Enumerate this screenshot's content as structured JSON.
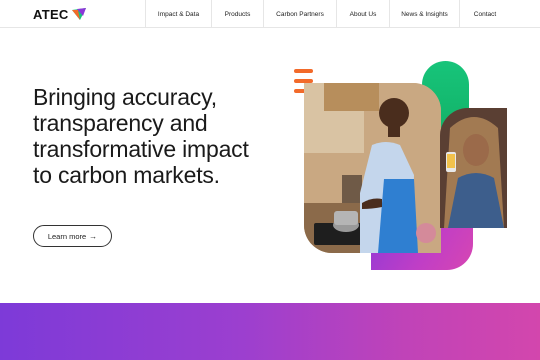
{
  "brand": {
    "name": "ATEC",
    "accent_green": "#17c47a",
    "accent_orange": "#f26a2a",
    "accent_purple": "#8a38d8",
    "accent_magenta": "#d346ad"
  },
  "nav": {
    "items": [
      {
        "label": "Impact & Data"
      },
      {
        "label": "Products"
      },
      {
        "label": "Carbon Partners"
      },
      {
        "label": "About Us"
      },
      {
        "label": "News & Insights"
      },
      {
        "label": "Contact"
      }
    ]
  },
  "hero": {
    "headline": "Bringing accuracy, transparency and transformative impact to carbon markets.",
    "cta_label": "Learn more",
    "cta_icon": "arrow-right-icon"
  }
}
